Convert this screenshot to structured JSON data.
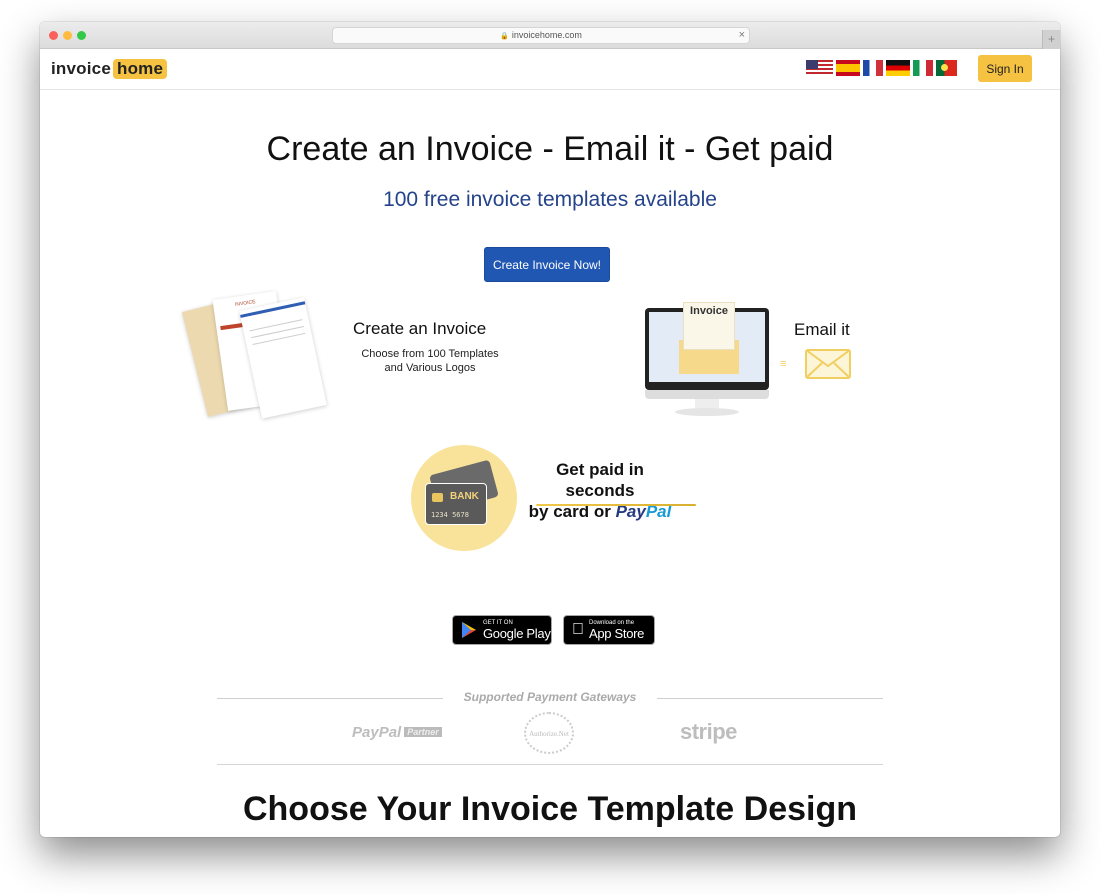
{
  "browser": {
    "url": "invoicehome.com",
    "new_tab_label": "+",
    "close_label": "×"
  },
  "navbar": {
    "logo_part1": "invoice",
    "logo_part2": "home",
    "languages": [
      {
        "code": "en-US",
        "name": "English (US)"
      },
      {
        "code": "es",
        "name": "Spanish"
      },
      {
        "code": "fr",
        "name": "French"
      },
      {
        "code": "de",
        "name": "German"
      },
      {
        "code": "it",
        "name": "Italian"
      },
      {
        "code": "pt",
        "name": "Portuguese"
      }
    ],
    "sign_in_label": "Sign In"
  },
  "hero": {
    "headline": "Create an Invoice - Email it - Get paid",
    "subheadline": "100 free invoice templates available",
    "cta_label": "Create Invoice Now!"
  },
  "features": {
    "create": {
      "title": "Create an Invoice",
      "desc_line1": "Choose from 100 Templates",
      "desc_line2": "and Various Logos",
      "doc_heading": "INVOICE"
    },
    "email": {
      "title": "Email it",
      "doc_label": "Invoice"
    },
    "pay": {
      "title_line1": "Get paid in seconds",
      "title_line2_prefix": "by card or ",
      "paypal_part1": "Pay",
      "paypal_part2": "Pal",
      "card_bank": "BANK",
      "card_number": "1234  5678"
    }
  },
  "apps": {
    "google_small": "GET IT ON",
    "google_big": "Google Play",
    "apple_small": "Download on the",
    "apple_big": "App Store"
  },
  "gateways": {
    "label": "Supported Payment Gateways",
    "paypal": "PayPal",
    "paypal_badge": "Partner",
    "authorize": "Authorize.Net",
    "stripe": "stripe"
  },
  "templates_section": {
    "title": "Choose Your Invoice Template Design"
  },
  "colors": {
    "accent_yellow": "#f5c242",
    "primary_blue": "#2057b3",
    "subheadline_blue": "#24438a"
  }
}
